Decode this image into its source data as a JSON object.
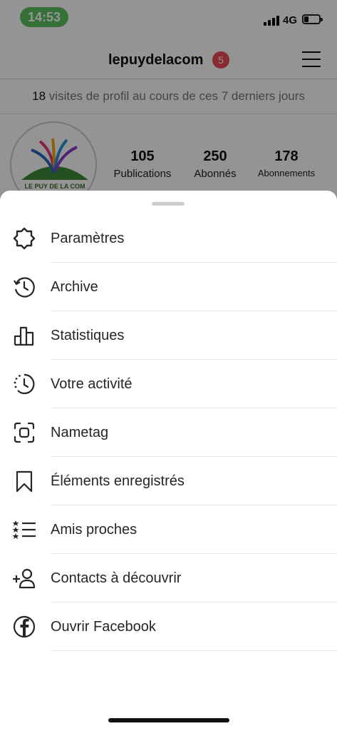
{
  "status_bar": {
    "time": "14:53",
    "network": "4G"
  },
  "profile": {
    "username": "lepuydelacom",
    "notification_count": "5",
    "visits_count": "18",
    "visits_text": "visites de profil au cours de ces 7 derniers jours",
    "avatar_text": "LE PUY DE LA COM",
    "stats": [
      {
        "value": "105",
        "label": "Publications"
      },
      {
        "value": "250",
        "label": "Abonnés"
      },
      {
        "value": "178",
        "label": "Abonnements"
      }
    ]
  },
  "menu": {
    "items": [
      {
        "label": "Paramètres",
        "icon": "settings-gear-icon"
      },
      {
        "label": "Archive",
        "icon": "archive-history-icon"
      },
      {
        "label": "Statistiques",
        "icon": "bar-chart-icon"
      },
      {
        "label": "Votre activité",
        "icon": "activity-clock-icon"
      },
      {
        "label": "Nametag",
        "icon": "nametag-scan-icon"
      },
      {
        "label": "Éléments enregistrés",
        "icon": "bookmark-icon"
      },
      {
        "label": "Amis proches",
        "icon": "close-friends-list-icon"
      },
      {
        "label": "Contacts à découvrir",
        "icon": "add-person-icon"
      },
      {
        "label": "Ouvrir Facebook",
        "icon": "facebook-icon"
      }
    ]
  }
}
